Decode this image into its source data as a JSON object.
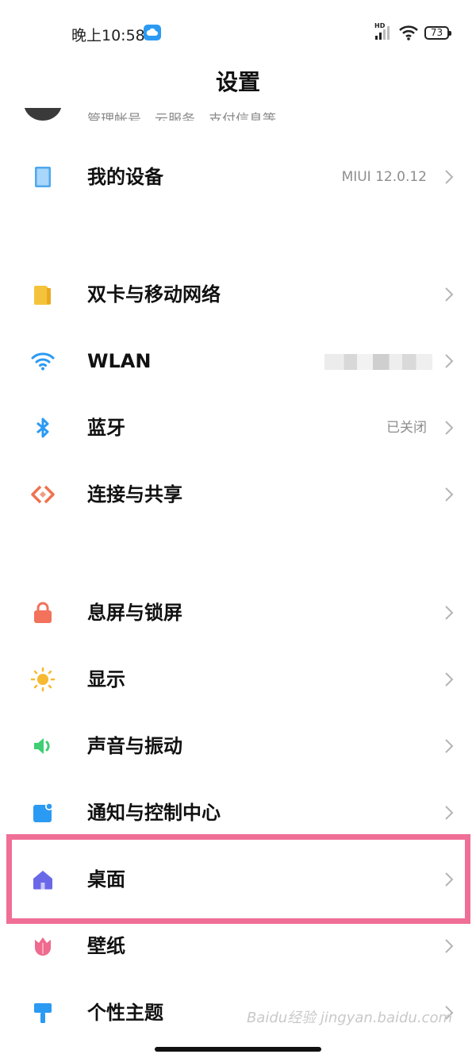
{
  "status_bar": {
    "time": "晚上10:58",
    "network_badge": "HD",
    "battery": "73"
  },
  "header": {
    "title": "设置"
  },
  "account": {
    "subtitle": "管理帐号、云服务、支付信息等"
  },
  "rows": [
    {
      "label": "我的设备",
      "value": "MIUI 12.0.12",
      "icon": "tablet-icon",
      "color": "#4fa8ee"
    },
    {
      "label": "双卡与移动网络",
      "value": "",
      "icon": "sim-card-icon",
      "color": "#f5c33b"
    },
    {
      "label": "WLAN",
      "value": "",
      "icon": "wifi-icon",
      "color": "#2b9af3"
    },
    {
      "label": "蓝牙",
      "value": "已关闭",
      "icon": "bluetooth-icon",
      "color": "#2b9af3"
    },
    {
      "label": "连接与共享",
      "value": "",
      "icon": "share-icon",
      "color": "#f0724f"
    },
    {
      "label": "息屏与锁屏",
      "value": "",
      "icon": "lock-icon",
      "color": "#f2725c"
    },
    {
      "label": "显示",
      "value": "",
      "icon": "sun-icon",
      "color": "#f6b931"
    },
    {
      "label": "声音与振动",
      "value": "",
      "icon": "speaker-icon",
      "color": "#3fce72"
    },
    {
      "label": "通知与控制中心",
      "value": "",
      "icon": "notification-icon",
      "color": "#2b9af3"
    },
    {
      "label": "桌面",
      "value": "",
      "icon": "home-icon",
      "color": "#6b68e8"
    },
    {
      "label": "壁纸",
      "value": "",
      "icon": "tulip-icon",
      "color": "#ef6a8e"
    },
    {
      "label": "个性主题",
      "value": "",
      "icon": "brush-icon",
      "color": "#2b9af3"
    }
  ],
  "highlight_color": "#ef6f96",
  "watermark": "Baidu经验 jingyan.baidu.com"
}
